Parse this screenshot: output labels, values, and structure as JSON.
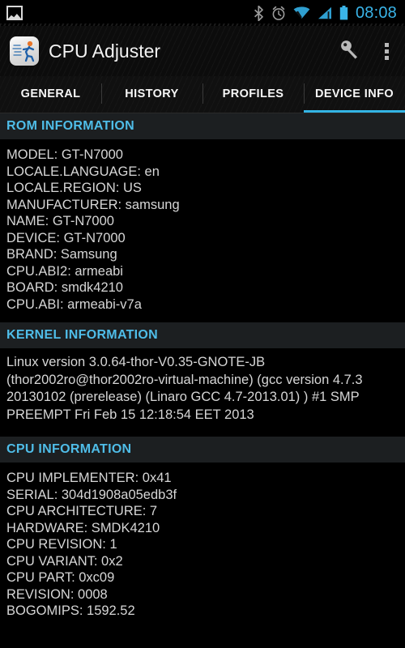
{
  "status_bar": {
    "notification_icon": "gallery-icon",
    "icons": [
      "bluetooth-icon",
      "alarm-icon",
      "wifi-icon",
      "signal-icon",
      "battery-icon"
    ],
    "time": "08:08",
    "accent_color": "#33b5e5"
  },
  "action_bar": {
    "app_icon": "runner-app-icon",
    "title": "CPU Adjuster",
    "actions": [
      {
        "name": "key-icon",
        "label": "Key"
      },
      {
        "name": "overflow-menu-icon",
        "label": "More options"
      }
    ]
  },
  "tabs": {
    "active_index": 3,
    "items": [
      {
        "label": "GENERAL"
      },
      {
        "label": "HISTORY"
      },
      {
        "label": "PROFILES"
      },
      {
        "label": "DEVICE INFO"
      }
    ]
  },
  "sections": {
    "rom": {
      "header": "ROM INFORMATION",
      "lines": [
        "MODEL: GT-N7000",
        "LOCALE.LANGUAGE: en",
        "LOCALE.REGION: US",
        "MANUFACTURER: samsung",
        "NAME: GT-N7000",
        "DEVICE: GT-N7000",
        "BRAND: Samsung",
        "CPU.ABI2: armeabi",
        "BOARD: smdk4210",
        "CPU.ABI: armeabi-v7a"
      ]
    },
    "kernel": {
      "header": "KERNEL INFORMATION",
      "text": "Linux version 3.0.64-thor-V0.35-GNOTE-JB (thor2002ro@thor2002ro-virtual-machine) (gcc version 4.7.3 20130102 (prerelease) (Linaro GCC 4.7-2013.01) ) #1 SMP PREEMPT Fri Feb 15 12:18:54 EET 2013"
    },
    "cpu": {
      "header": "CPU INFORMATION",
      "lines": [
        "CPU IMPLEMENTER: 0x41",
        "SERIAL: 304d1908a05edb3f",
        "CPU ARCHITECTURE: 7",
        "HARDWARE: SMDK4210",
        "CPU REVISION: 1",
        "CPU VARIANT: 0x2",
        "CPU PART: 0xc09",
        "REVISION: 0008",
        "BOGOMIPS: 1592.52"
      ]
    }
  }
}
